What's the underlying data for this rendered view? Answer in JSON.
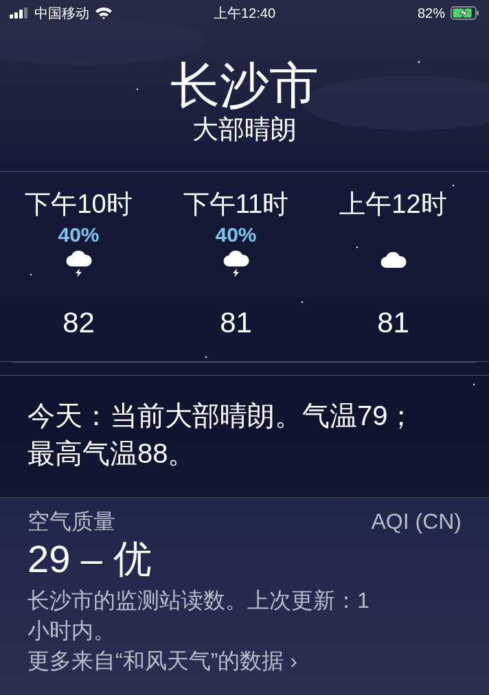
{
  "status_bar": {
    "carrier": "中国移动",
    "time": "上午12:40",
    "battery": "82%"
  },
  "header": {
    "city": "长沙市",
    "condition": "大部晴朗"
  },
  "hourly": [
    {
      "time": "下午10时",
      "precipitation": "40%",
      "kind": "storm",
      "temperature": "82"
    },
    {
      "time": "下午11时",
      "precipitation": "40%",
      "kind": "storm",
      "temperature": "81"
    },
    {
      "time": "上午12时",
      "kind": "cloud",
      "temperature": "81"
    }
  ],
  "summary": "今天：当前大部晴朗。气温79；最高气温88。",
  "air_quality": {
    "label": "空气质量",
    "scale": "AQI (CN)",
    "value": "29 – 优",
    "description": "长沙市的监测站读数。上次更新：1小时内。",
    "link": "更多来自“和风天气”的数据 ›"
  }
}
